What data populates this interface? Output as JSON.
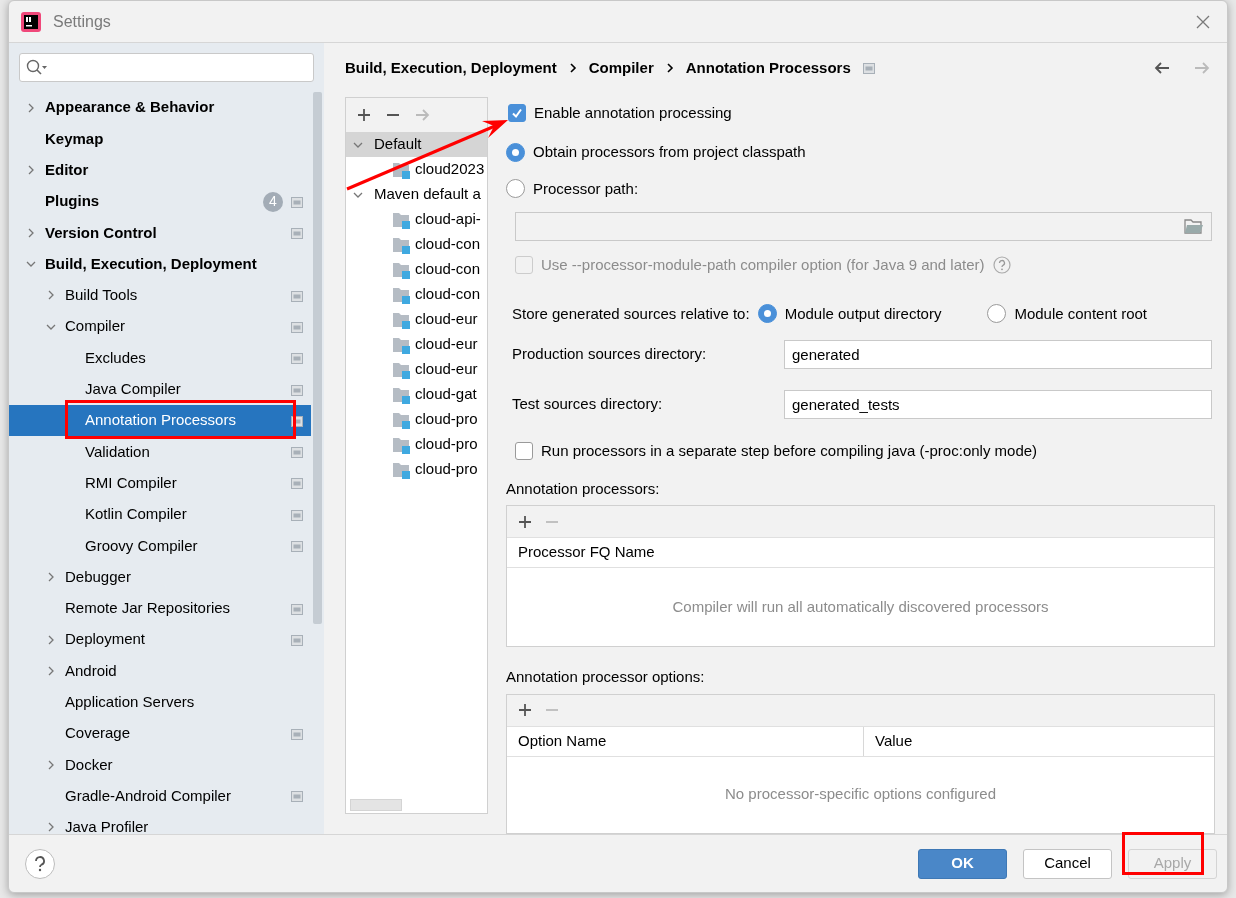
{
  "window": {
    "title": "Settings"
  },
  "sidebar": {
    "items": [
      {
        "label": "Appearance & Behavior",
        "expanded": false,
        "selected": false
      },
      {
        "label": "Keymap",
        "selected": false
      },
      {
        "label": "Editor",
        "expanded": false,
        "selected": false
      },
      {
        "label": "Plugins",
        "badge": "4",
        "project_scope": true,
        "selected": false
      },
      {
        "label": "Version Control",
        "expanded": false,
        "project_scope": true,
        "selected": false
      },
      {
        "label": "Build, Execution, Deployment",
        "expanded": true,
        "selected": false,
        "children": [
          {
            "label": "Build Tools",
            "expanded": false,
            "project_scope": true,
            "selected": false
          },
          {
            "label": "Compiler",
            "expanded": true,
            "project_scope": true,
            "selected": false,
            "children": [
              {
                "label": "Excludes",
                "project_scope": true,
                "selected": false
              },
              {
                "label": "Java Compiler",
                "project_scope": true,
                "selected": false
              },
              {
                "label": "Annotation Processors",
                "project_scope": true,
                "selected": true,
                "highlighted": true
              },
              {
                "label": "Validation",
                "project_scope": true,
                "selected": false
              },
              {
                "label": "RMI Compiler",
                "project_scope": true,
                "selected": false
              },
              {
                "label": "Kotlin Compiler",
                "project_scope": true,
                "selected": false
              },
              {
                "label": "Groovy Compiler",
                "project_scope": true,
                "selected": false
              }
            ]
          },
          {
            "label": "Debugger",
            "expanded": false,
            "selected": false
          },
          {
            "label": "Remote Jar Repositories",
            "project_scope": true,
            "selected": false
          },
          {
            "label": "Deployment",
            "expanded": false,
            "project_scope": true,
            "selected": false
          },
          {
            "label": "Android",
            "expanded": false,
            "selected": false
          },
          {
            "label": "Application Servers",
            "selected": false
          },
          {
            "label": "Coverage",
            "project_scope": true,
            "selected": false
          },
          {
            "label": "Docker",
            "expanded": false,
            "selected": false
          },
          {
            "label": "Gradle-Android Compiler",
            "project_scope": true,
            "selected": false
          },
          {
            "label": "Java Profiler",
            "expanded": false,
            "selected": false
          }
        ]
      }
    ]
  },
  "breadcrumb": [
    "Build, Execution, Deployment",
    "Compiler",
    "Annotation Processors"
  ],
  "navigation": {
    "back_disabled": false,
    "forward_disabled": true
  },
  "profiles": {
    "toolbar": [
      {
        "kind": "add",
        "disabled": false
      },
      {
        "kind": "remove",
        "disabled": false
      },
      {
        "kind": "move",
        "disabled": true
      }
    ],
    "tree": [
      {
        "label": "Default",
        "selected": true,
        "expanded": true,
        "children": [
          {
            "label": "cloud2023",
            "selected": false
          }
        ]
      },
      {
        "label": "Maven default a",
        "selected": false,
        "expanded": true,
        "children": [
          {
            "label": "cloud-api-",
            "selected": false
          },
          {
            "label": "cloud-con",
            "selected": false
          },
          {
            "label": "cloud-con",
            "selected": false
          },
          {
            "label": "cloud-con",
            "selected": false
          },
          {
            "label": "cloud-eur",
            "selected": false
          },
          {
            "label": "cloud-eur",
            "selected": false
          },
          {
            "label": "cloud-eur",
            "selected": false
          },
          {
            "label": "cloud-gat",
            "selected": false
          },
          {
            "label": "cloud-pro",
            "selected": false
          },
          {
            "label": "cloud-pro",
            "selected": false
          },
          {
            "label": "cloud-pro",
            "selected": false
          }
        ]
      }
    ]
  },
  "enable_processing": {
    "label": "Enable annotation processing",
    "checked": true,
    "arrow": true
  },
  "processor_source": [
    {
      "label": "Obtain processors from project classpath",
      "selected": true
    },
    {
      "label": "Processor path:",
      "selected": false
    }
  ],
  "processor_path": {
    "disabled": true
  },
  "module_path_option": {
    "label": "Use --processor-module-path compiler option (for Java 9 and later)",
    "checked": false,
    "disabled": true
  },
  "store_relative": {
    "label": "Store generated sources relative to:",
    "options": [
      {
        "label": "Module output directory",
        "selected": true
      },
      {
        "label": "Module content root",
        "selected": false
      }
    ]
  },
  "production_dir": {
    "label": "Production sources directory:",
    "value": "generated"
  },
  "test_dir": {
    "label": "Test sources directory:",
    "value": "generated_tests"
  },
  "run_separately": {
    "label": "Run processors in a separate step before compiling java (-proc:only mode)",
    "checked": false,
    "disabled": false
  },
  "processors_table": {
    "title": "Annotation processors:",
    "toolbar": [
      {
        "kind": "add",
        "disabled": false
      },
      {
        "kind": "remove",
        "disabled": true
      }
    ],
    "columns": [
      "Processor FQ Name"
    ],
    "empty_text": "Compiler will run all automatically discovered processors"
  },
  "options_table": {
    "title": "Annotation processor options:",
    "toolbar": [
      {
        "kind": "add",
        "disabled": false
      },
      {
        "kind": "remove",
        "disabled": true
      }
    ],
    "columns": [
      "Option Name",
      "Value"
    ],
    "empty_text": "No processor-specific options configured"
  },
  "buttons": [
    {
      "label": "OK",
      "kind": "primary",
      "disabled": false,
      "highlighted": false
    },
    {
      "label": "Cancel",
      "kind": "secondary",
      "disabled": false,
      "highlighted": false
    },
    {
      "label": "Apply",
      "kind": "secondary",
      "disabled": true,
      "highlighted": true
    }
  ]
}
